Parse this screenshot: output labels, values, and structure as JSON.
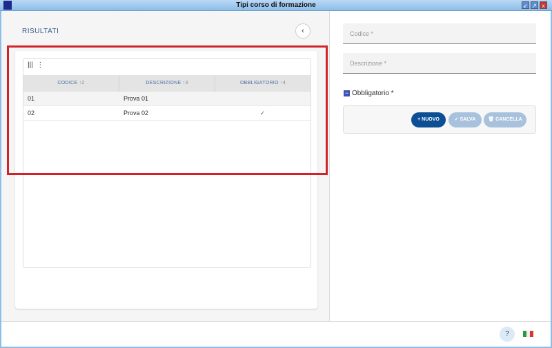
{
  "window": {
    "title": "Tipi corso di formazione"
  },
  "left": {
    "section_title": "RISULTATI",
    "back_icon": "‹",
    "grid": {
      "tools": {
        "columns_icon": "|||",
        "menu_icon": "⋮"
      },
      "columns": [
        {
          "label": "CODICE",
          "sort": "↑2"
        },
        {
          "label": "DESCRIZIONE",
          "sort": "↑3"
        },
        {
          "label": "OBBLIGATORIO",
          "sort": "↑4"
        }
      ],
      "rows": [
        {
          "codice": "01",
          "descrizione": "Prova 01",
          "obbligatorio": ""
        },
        {
          "codice": "02",
          "descrizione": "Prova 02",
          "obbligatorio": "✓"
        }
      ]
    }
  },
  "form": {
    "codice_placeholder": "Codice *",
    "descrizione_placeholder": "Descrizione *",
    "obbligatorio_label": "Obbligatorio *",
    "obbligatorio_state": "−",
    "buttons": {
      "nuovo": "+ NUOVO",
      "salva": "✓ SALVA",
      "cancella": "🗑 CANCELLA"
    }
  },
  "footer": {
    "help": "?"
  }
}
